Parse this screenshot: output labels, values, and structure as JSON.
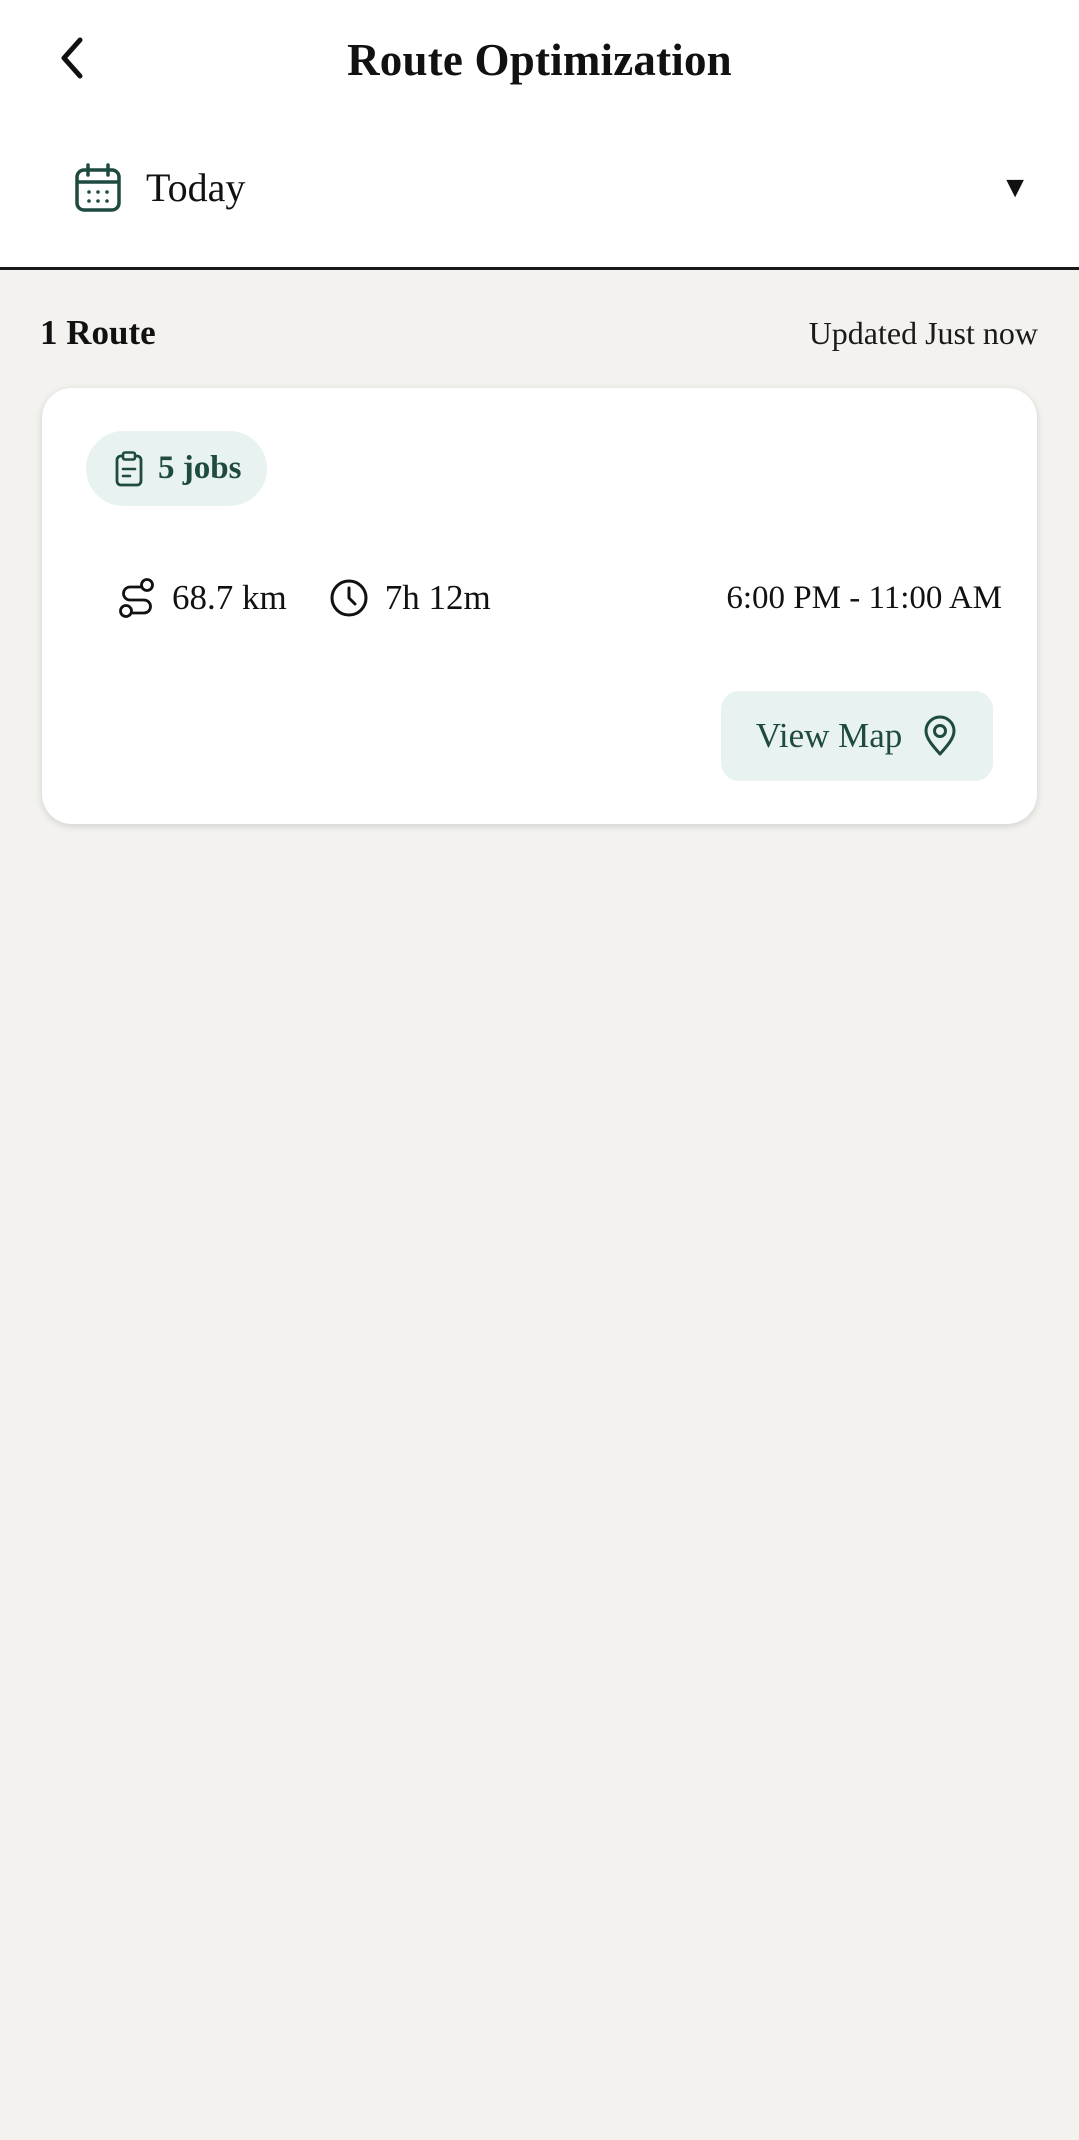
{
  "header": {
    "title": "Route Optimization",
    "back_icon": "chevron-left-icon"
  },
  "date_filter": {
    "icon": "calendar-icon",
    "selected": "Today",
    "caret": "▼"
  },
  "summary": {
    "route_count": "1 Route",
    "updated": "Updated Just now"
  },
  "route_card": {
    "jobs_icon": "clipboard-icon",
    "jobs_label": "5 jobs",
    "distance_icon": "route-icon",
    "distance": "68.7 km",
    "duration_icon": "clock-icon",
    "duration": "7h 12m",
    "time_window": "6:00 PM - 11:00 AM",
    "view_map_label": "View Map",
    "view_map_icon": "map-pin-icon"
  },
  "colors": {
    "accent": "#1f4a40",
    "accent_bg": "#e8f3f1",
    "page_bg": "#f3f2ef",
    "card_bg": "#ffffff"
  }
}
